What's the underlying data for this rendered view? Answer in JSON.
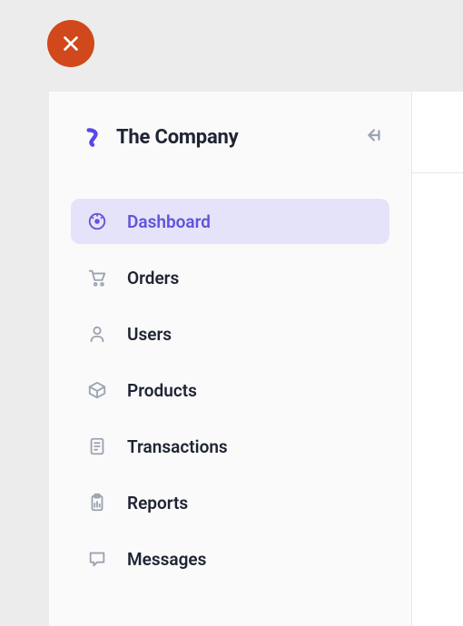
{
  "brand": {
    "name": "The Company"
  },
  "colors": {
    "accent": "#6054d8",
    "active_bg": "#e5e3fa",
    "close_bg": "#d1481c"
  },
  "nav": {
    "items": [
      {
        "icon": "dashboard-icon",
        "label": "Dashboard",
        "active": true
      },
      {
        "icon": "cart-icon",
        "label": "Orders",
        "active": false
      },
      {
        "icon": "user-icon",
        "label": "Users",
        "active": false
      },
      {
        "icon": "box-icon",
        "label": "Products",
        "active": false
      },
      {
        "icon": "receipt-icon",
        "label": "Transactions",
        "active": false
      },
      {
        "icon": "clipboard-icon",
        "label": "Reports",
        "active": false
      },
      {
        "icon": "message-icon",
        "label": "Messages",
        "active": false
      }
    ]
  }
}
